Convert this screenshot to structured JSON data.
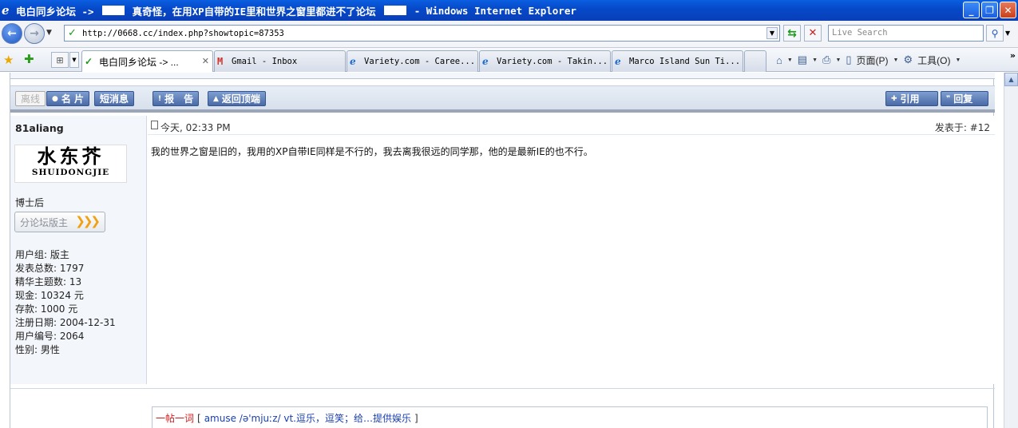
{
  "window": {
    "title_prefix": "电白同乡论坛 ->",
    "title_subject": "真奇怪，在用XP自带的IE里和世界之窗里都进不了论坛",
    "title_suffix": "- Windows Internet Explorer",
    "minimize": "_",
    "maximize": "❐",
    "close": "✕"
  },
  "address": {
    "url": "http://0668.cc/index.php?showtopic=87353",
    "search_placeholder": "Live Search"
  },
  "tabs": [
    {
      "label": "电白同乡论坛 -> ...",
      "icon": "check-icon",
      "active": true,
      "close": "✕"
    },
    {
      "label": "Gmail - Inbox",
      "icon": "gmail-icon",
      "active": false
    },
    {
      "label": "Variety.com - Caree...",
      "icon": "ie-icon",
      "active": false
    },
    {
      "label": "Variety.com - Takin...",
      "icon": "ie-icon",
      "active": false
    },
    {
      "label": "Marco Island Sun Ti...",
      "icon": "ie-icon",
      "active": false
    }
  ],
  "toolbar": {
    "page_label": "页面(P)",
    "tools_label": "工具(O)",
    "more": "»"
  },
  "actions": {
    "offline": "离线",
    "card": "名 片",
    "message": "短消息",
    "report": "报　告",
    "back_to_top": "返回顶端",
    "quote": "引用",
    "reply": "回复"
  },
  "author": {
    "name": "81aliang",
    "avatar_cn": "水东芥",
    "avatar_en": "SHUIDONGJIE",
    "rank": "博士后",
    "badge": "分论坛版主",
    "stats": [
      "用户组: 版主",
      "发表总数: 1797",
      "精华主题数: 13",
      "现金: 10324 元",
      "存款: 1000 元",
      "注册日期: 2004-12-31",
      "用户编号: 2064",
      "性别: 男性"
    ]
  },
  "post": {
    "time": "今天, 02:33 PM",
    "floor": "发表于: #12",
    "body": "我的世界之窗是旧的，我用的XP自带IE同样是不行的，我去离我很远的同学那，他的是最新IE的也不行。"
  },
  "word_of_day": {
    "title": "一帖一词",
    "open": "[",
    "word": "amuse /ə'mjuːz/ vt.逗乐，逗笑；给…提供娱乐",
    "close": "]"
  }
}
